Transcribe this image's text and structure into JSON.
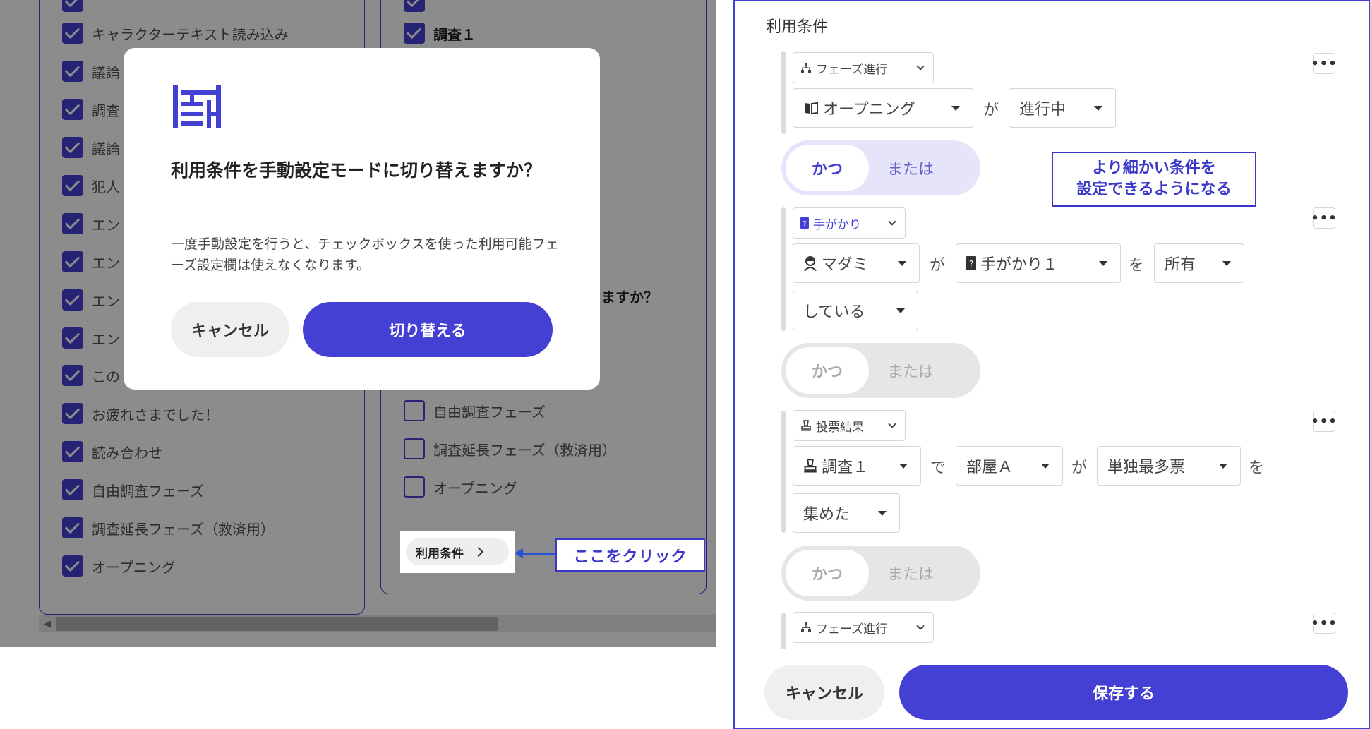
{
  "background_page": {
    "left_panel_items": [
      {
        "label": "",
        "checked": true
      },
      {
        "label": "キャラクターテキスト読み込み",
        "checked": true
      },
      {
        "label": "議論",
        "checked": true
      },
      {
        "label": "調査",
        "checked": true
      },
      {
        "label": "議論",
        "checked": true
      },
      {
        "label": "犯人",
        "checked": true
      },
      {
        "label": "エン",
        "checked": true
      },
      {
        "label": "エン",
        "checked": true
      },
      {
        "label": "エン",
        "checked": true
      },
      {
        "label": "エン",
        "checked": true
      },
      {
        "label": "この",
        "checked": true
      },
      {
        "label": "お疲れさまでした！",
        "checked": true
      },
      {
        "label": "読み合わせ",
        "checked": true
      },
      {
        "label": "自由調査フェーズ",
        "checked": true
      },
      {
        "label": "調査延長フェーズ（救済用）",
        "checked": true
      },
      {
        "label": "オープニング",
        "checked": true
      }
    ],
    "right_panel_top_items": [
      {
        "label": "",
        "checked": true
      },
      {
        "label": "調査１",
        "checked": true
      }
    ],
    "right_panel_question_fragment": "ますか？",
    "right_panel_bottom_items": [
      {
        "label": "自由調査フェーズ",
        "checked": false
      },
      {
        "label": "調査延長フェーズ（救済用）",
        "checked": false
      },
      {
        "label": "オープニング",
        "checked": false
      }
    ],
    "conditions_chip_label": "利用条件"
  },
  "callout_click": "ここをクリック",
  "modal": {
    "title": "利用条件を手動設定モードに切り替えますか？",
    "body": "一度手動設定を行うと、チェックボックスを使った利用可能フェーズ設定欄は使えなくなります。",
    "cancel_label": "キャンセル",
    "confirm_label": "切り替える"
  },
  "editor": {
    "title": "利用条件",
    "callout_detail_line1": "より細かい条件を",
    "callout_detail_line2": "設定できるようになる",
    "blocks": [
      {
        "type_label": "フェーズ進行",
        "type_icon": "hierarchy-icon",
        "fields": [
          "オープニング",
          "が",
          "進行中"
        ]
      },
      {
        "type_label": "手がかり",
        "type_icon": "clue-card-icon",
        "fields": [
          "マダミ",
          "が",
          "手がかり１",
          "を",
          "所有",
          "している"
        ]
      },
      {
        "type_label": "投票結果",
        "type_icon": "vote-stamp-icon",
        "fields": [
          "調査１",
          "で",
          "部屋Ａ",
          "が",
          "単独最多票",
          "を",
          "集めた"
        ]
      },
      {
        "type_label": "フェーズ進行",
        "type_icon": "hierarchy-icon",
        "fields": []
      }
    ],
    "toggles": [
      {
        "and_label": "かつ",
        "or_label": "または",
        "active": true
      },
      {
        "and_label": "かつ",
        "or_label": "または",
        "active": false
      },
      {
        "and_label": "かつ",
        "or_label": "または",
        "active": false
      }
    ],
    "more_label": "•••",
    "cancel_label": "キャンセル",
    "save_label": "保存する"
  },
  "colors": {
    "accent": "#4540d4",
    "callout": "#3a37c9",
    "toggle_active_bg": "#e5e4fb",
    "toggle_inactive_bg": "#e6e6e6"
  }
}
